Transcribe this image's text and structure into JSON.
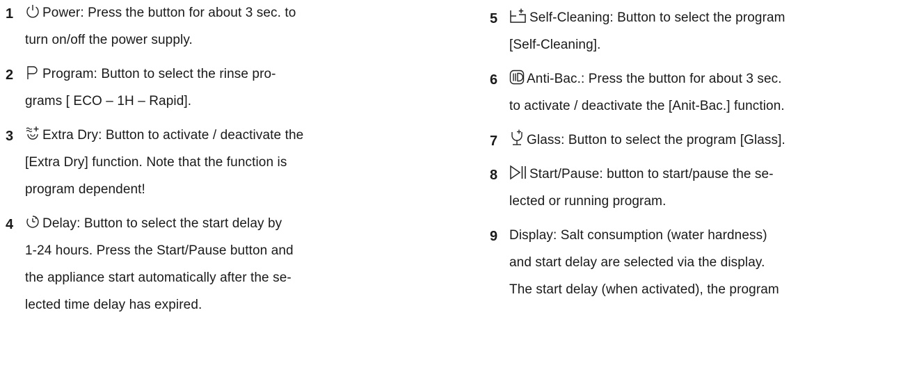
{
  "left_column": [
    {
      "number": "1",
      "icon": "power-icon",
      "lines": [
        "Power: Press the button for about 3 sec. to",
        "turn on/off the power supply."
      ]
    },
    {
      "number": "2",
      "icon": "program-icon",
      "lines": [
        "Program: Button to select the rinse pro-",
        "grams [ ECO – 1H – Rapid]."
      ]
    },
    {
      "number": "3",
      "icon": "extra-dry-icon",
      "lines": [
        "Extra Dry: Button to activate / deactivate the",
        "[Extra Dry] function. Note that the function is",
        "program dependent!"
      ]
    },
    {
      "number": "4",
      "icon": "delay-icon",
      "lines": [
        "Delay: Button to select the start delay by",
        "1-24 hours. Press the Start/Pause button and",
        "the appliance start automatically after the se-",
        "lected time delay has expired."
      ]
    }
  ],
  "right_column": [
    {
      "number": "5",
      "icon": "self-cleaning-icon",
      "lines": [
        "Self-Cleaning: Button to select the program",
        "[Self-Cleaning]."
      ]
    },
    {
      "number": "6",
      "icon": "anti-bac-icon",
      "lines": [
        "Anti-Bac.: Press the button for about 3 sec.",
        "to activate / deactivate the [Anit-Bac.] function."
      ]
    },
    {
      "number": "7",
      "icon": "glass-icon",
      "lines": [
        "Glass: Button to select the program [Glass]."
      ]
    },
    {
      "number": "8",
      "icon": "start-pause-icon",
      "lines": [
        "Start/Pause: button to start/pause the se-",
        "lected or running program."
      ]
    },
    {
      "number": "9",
      "icon": "",
      "lines": [
        "Display: Salt consumption (water hardness)",
        "and start delay are selected via the display.",
        "The start delay (when activated), the program"
      ]
    }
  ]
}
